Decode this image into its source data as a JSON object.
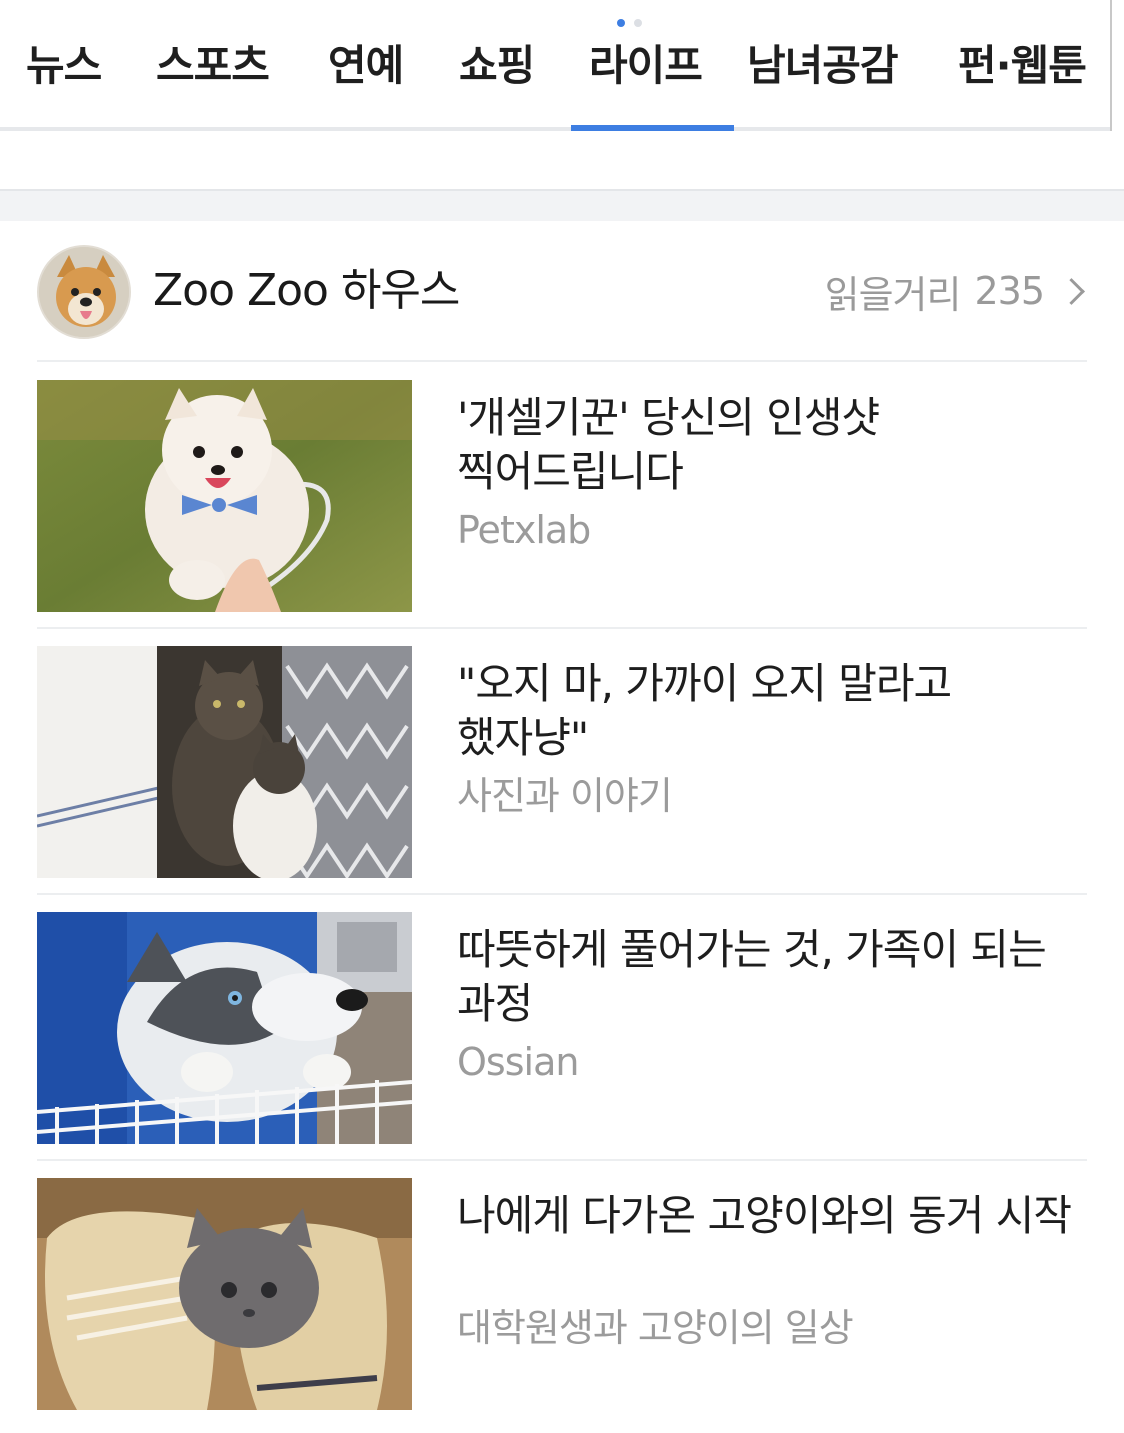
{
  "tabs": [
    {
      "label": "뉴스",
      "active": false
    },
    {
      "label": "스포츠",
      "active": false
    },
    {
      "label": "연예",
      "active": false
    },
    {
      "label": "쇼핑",
      "active": false
    },
    {
      "label": "라이프",
      "active": true
    },
    {
      "label": "남녀공감",
      "active": false
    },
    {
      "label": "펀·웹툰",
      "active": false
    }
  ],
  "page_indicator": {
    "current": 1,
    "total": 2
  },
  "section": {
    "title": "Zoo Zoo 하우스",
    "more_label": "읽을거리",
    "more_count": "235",
    "avatar_icon": "puppy-avatar"
  },
  "articles": [
    {
      "title": "'개셀기꾼' 당신의 인생샷 찍어드립니다",
      "source": "Petxlab",
      "thumb": "pomeranian-photo"
    },
    {
      "title": "\"오지 마, 가까이 오지 말라고 했자냥\"",
      "source": "사진과 이야기",
      "thumb": "two-cats-photo"
    },
    {
      "title": "따뜻하게 풀어가는 것, 가족이 되는 과정",
      "source": "Ossian",
      "thumb": "husky-photo"
    },
    {
      "title": "나에게 다가온 고양이와의 동거 시작",
      "source": "대학원생과 고양이의 일상",
      "thumb": "kitten-in-shoe-photo"
    }
  ],
  "colors": {
    "accent": "#3d7ee2",
    "text": "#1e1e1e",
    "muted": "#9b9b9b",
    "band": "#f2f3f5"
  }
}
